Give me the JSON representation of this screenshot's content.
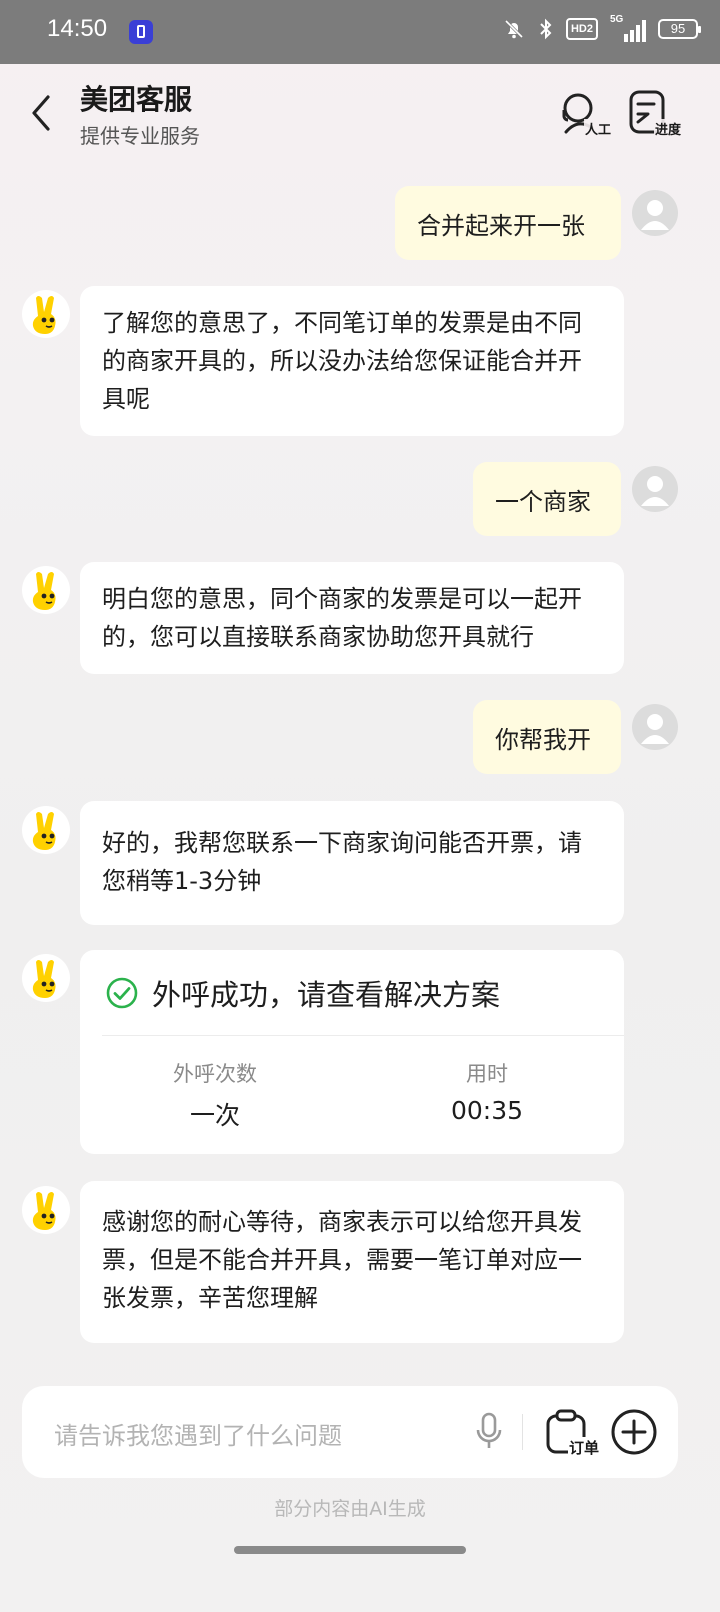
{
  "status_bar": {
    "time": "14:50",
    "hd_badge": "HD2",
    "signal_label": "5G",
    "battery": "95"
  },
  "header": {
    "title": "美团客服",
    "subtitle": "提供专业服务",
    "human_agent_label": "人工",
    "progress_label": "进度"
  },
  "messages": [
    {
      "from": "user",
      "text": "合并起来开一张"
    },
    {
      "from": "bot",
      "text": "了解您的意思了，不同笔订单的发票是由不同的商家开具的，所以没办法给您保证能合并开具呢"
    },
    {
      "from": "user",
      "text": "一个商家"
    },
    {
      "from": "bot",
      "text": "明白您的意思，同个商家的发票是可以一起开的，您可以直接联系商家协助您开具就行"
    },
    {
      "from": "user",
      "text": "你帮我开"
    },
    {
      "from": "bot",
      "text": "好的，我帮您联系一下商家询问能否开票，请您稍等1-3分钟"
    },
    {
      "from": "bot",
      "text": "感谢您的耐心等待，商家表示可以给您开具发票，但是不能合并开具，需要一笔订单对应一张发票，辛苦您理解"
    }
  ],
  "call_card": {
    "title": "外呼成功，请查看解决方案",
    "call_count_label": "外呼次数",
    "call_count_value": "一次",
    "duration_label": "用时",
    "duration_value": "00:35"
  },
  "input": {
    "placeholder": "请告诉我您遇到了什么问题",
    "order_label": "订单"
  },
  "footer_note": "部分内容由AI生成",
  "colors": {
    "user_bubble": "#fffbe0",
    "success_green": "#2bb24c",
    "mascot_yellow": "#ffd100"
  }
}
